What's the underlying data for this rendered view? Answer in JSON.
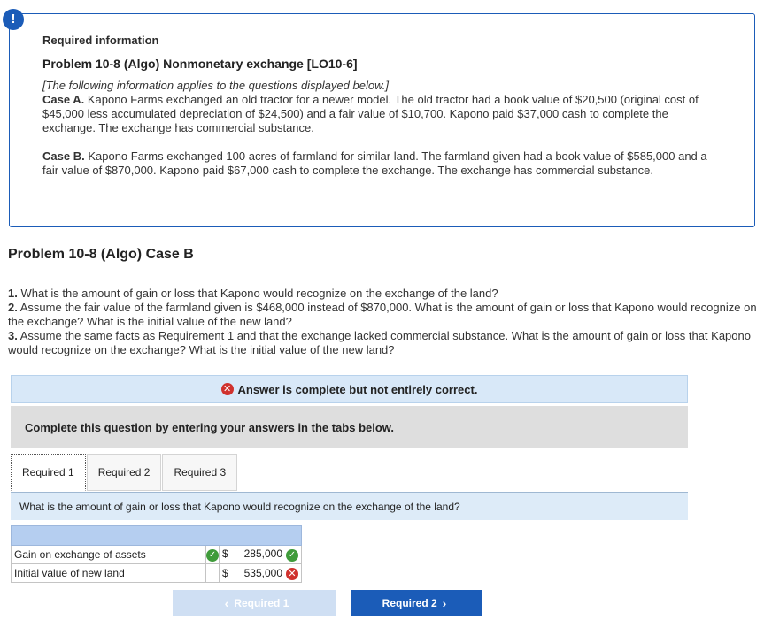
{
  "info": {
    "heading": "Required information",
    "problem_title": "Problem 10-8 (Algo) Nonmonetary exchange [LO10-6]",
    "intro": "[The following information applies to the questions displayed below.]",
    "case_a_label": "Case A.",
    "case_a_text": "Kapono Farms exchanged an old tractor for a newer model. The old tractor had a book value of $20,500 (original cost of $45,000 less accumulated depreciation of $24,500) and a fair value of $10,700. Kapono paid $37,000 cash to complete the exchange. The exchange has commercial substance.",
    "case_b_label": "Case B.",
    "case_b_text": "Kapono Farms exchanged 100 acres of farmland for similar land. The farmland given had a book value of $585,000 and a fair value of $870,000. Kapono paid $67,000 cash to complete the exchange. The exchange has commercial substance."
  },
  "case_title": "Problem 10-8 (Algo) Case B",
  "questions": [
    {
      "num": "1.",
      "text": "What is the amount of gain or loss that Kapono would recognize on the exchange of the land?"
    },
    {
      "num": "2.",
      "text": "Assume the fair value of the farmland given is $468,000 instead of $870,000. What is the amount of gain or loss that Kapono would recognize on the exchange? What is the initial value of the new land?"
    },
    {
      "num": "3.",
      "text": "Assume the same facts as Requirement 1 and that the exchange lacked commercial substance. What is the amount of gain or loss that Kapono would recognize on the exchange? What is the initial value of the new land?"
    }
  ],
  "status_banner": "Answer is complete but not entirely correct.",
  "complete_prompt": "Complete this question by entering your answers in the tabs below.",
  "tabs": [
    "Required 1",
    "Required 2",
    "Required 3"
  ],
  "tab_question": "What is the amount of gain or loss that Kapono would recognize on the exchange of the land?",
  "table": {
    "rows": [
      {
        "label": "Gain on exchange of assets",
        "label_status": "correct",
        "currency": "$",
        "value": "285,000",
        "value_status": "correct"
      },
      {
        "label": "Initial value of new land",
        "label_status": "",
        "currency": "$",
        "value": "535,000",
        "value_status": "incorrect"
      }
    ]
  },
  "nav": {
    "prev_label": "Required 1",
    "next_label": "Required 2"
  },
  "colors": {
    "accent": "#1b5cb8",
    "correct": "#3f9b3a",
    "incorrect": "#d0312d",
    "banner_bg": "#d8e8f8"
  }
}
